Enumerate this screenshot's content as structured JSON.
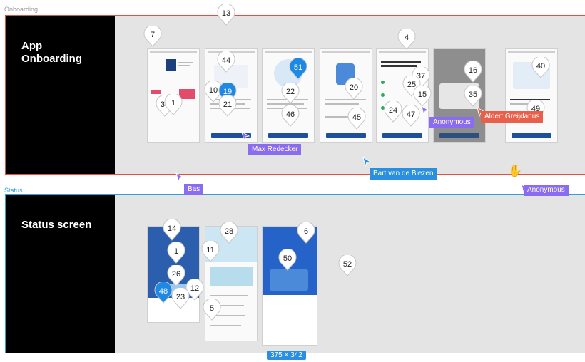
{
  "frames": {
    "onboarding_label": "Onboarding",
    "status_label": "Status",
    "onboarding_title": "App\nOnboarding",
    "status_title": "Status screen"
  },
  "size_badge": "375 × 342",
  "cursors": [
    {
      "name": "Max Redecker",
      "color": "#8a6cf0"
    },
    {
      "name": "Bas",
      "color": "#8a6cf0"
    },
    {
      "name": "Anonymous",
      "color": "#8a6cf0"
    },
    {
      "name": "Aldert Greijdanus",
      "color": "#e8604a"
    },
    {
      "name": "Bart van de Biezen",
      "color": "#2a8fe0"
    },
    {
      "name": "Anonymous",
      "color": "#8a6cf0"
    }
  ],
  "comment_pins": [
    "13",
    "7",
    "4",
    "44",
    "51",
    "37",
    "16",
    "40",
    "10",
    "19",
    "22",
    "20",
    "25",
    "15",
    "35",
    "49",
    "38",
    "1",
    "21",
    "46",
    "24",
    "47",
    "45",
    "14",
    "28",
    "6",
    "1",
    "11",
    "50",
    "52",
    "26",
    "48",
    "12",
    "23",
    "5"
  ],
  "accent": "#1e88e5"
}
